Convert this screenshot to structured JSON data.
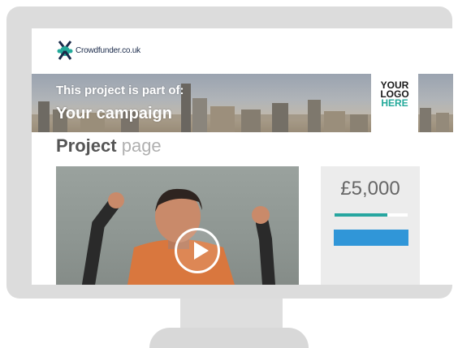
{
  "header": {
    "logo_text": "Crowdfunder.co.uk"
  },
  "banner": {
    "kicker": "This project is part of:",
    "title": "Your campaign",
    "logo_placeholder": [
      "YOUR",
      "LOGO",
      "HERE"
    ]
  },
  "page": {
    "title_bold": "Project",
    "title_light": "page"
  },
  "funding": {
    "amount": "£5,000",
    "progress_fraction": 0.72
  },
  "colors": {
    "brand_teal": "#27a6a0",
    "button_blue": "#3096d8",
    "logo_navy": "#1a2a4a"
  },
  "icons": {
    "play": "play-icon",
    "logo": "crowdfunder-logo-icon"
  }
}
